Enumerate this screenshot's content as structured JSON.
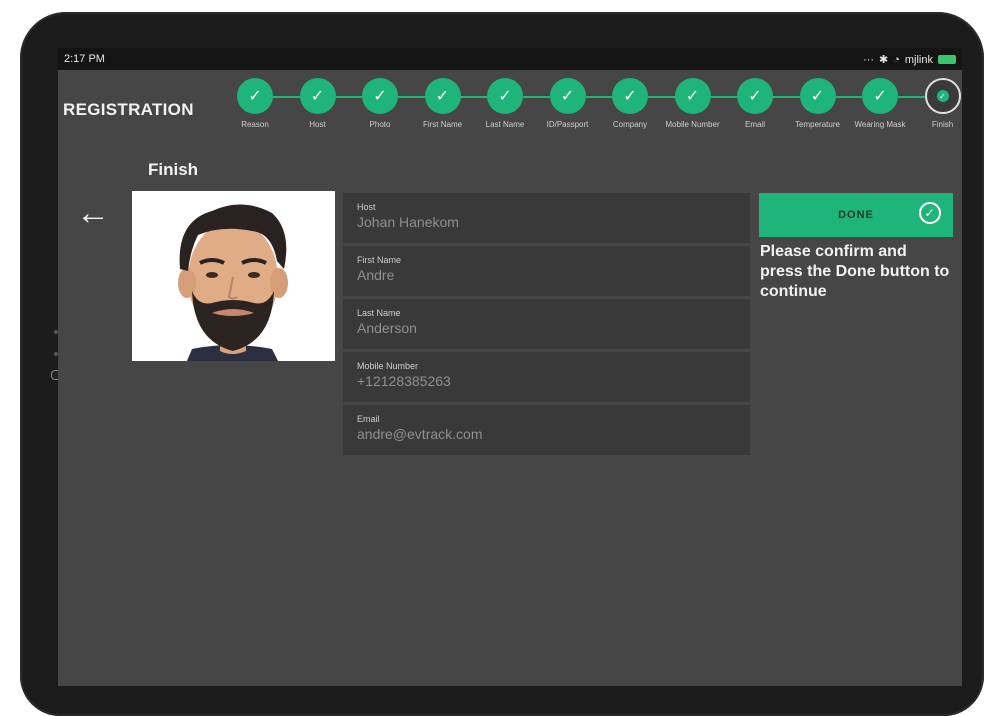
{
  "status_bar": {
    "time": "2:17 PM",
    "network": "mjlink"
  },
  "header": {
    "title": "REGISTRATION"
  },
  "steps": [
    {
      "label": "Reason",
      "done": true
    },
    {
      "label": "Host",
      "done": true
    },
    {
      "label": "Photo",
      "done": true
    },
    {
      "label": "First Name",
      "done": true
    },
    {
      "label": "Last Name",
      "done": true
    },
    {
      "label": "ID/Passport",
      "done": true
    },
    {
      "label": "Company",
      "done": true
    },
    {
      "label": "Mobile Number",
      "done": true
    },
    {
      "label": "Email",
      "done": true
    },
    {
      "label": "Temperature",
      "done": true
    },
    {
      "label": "Wearing Mask",
      "done": true
    },
    {
      "label": "Finish",
      "done": false,
      "current": true
    }
  ],
  "page": {
    "heading": "Finish"
  },
  "fields": [
    {
      "label": "Host",
      "value": "Johan Hanekom"
    },
    {
      "label": "First Name",
      "value": "Andre"
    },
    {
      "label": "Last Name",
      "value": "Anderson"
    },
    {
      "label": "Mobile Number",
      "value": "+12128385263"
    },
    {
      "label": "Email",
      "value": "andre@evtrack.com"
    }
  ],
  "done_button": {
    "label": "DONE"
  },
  "instructions": "Please confirm and press the Done button to continue",
  "colors": {
    "accent": "#1fb57a",
    "background": "#464646",
    "field": "#393939"
  },
  "icons": {
    "back": "arrow-left-icon",
    "done": "check-circle-icon",
    "step": "check-icon"
  }
}
